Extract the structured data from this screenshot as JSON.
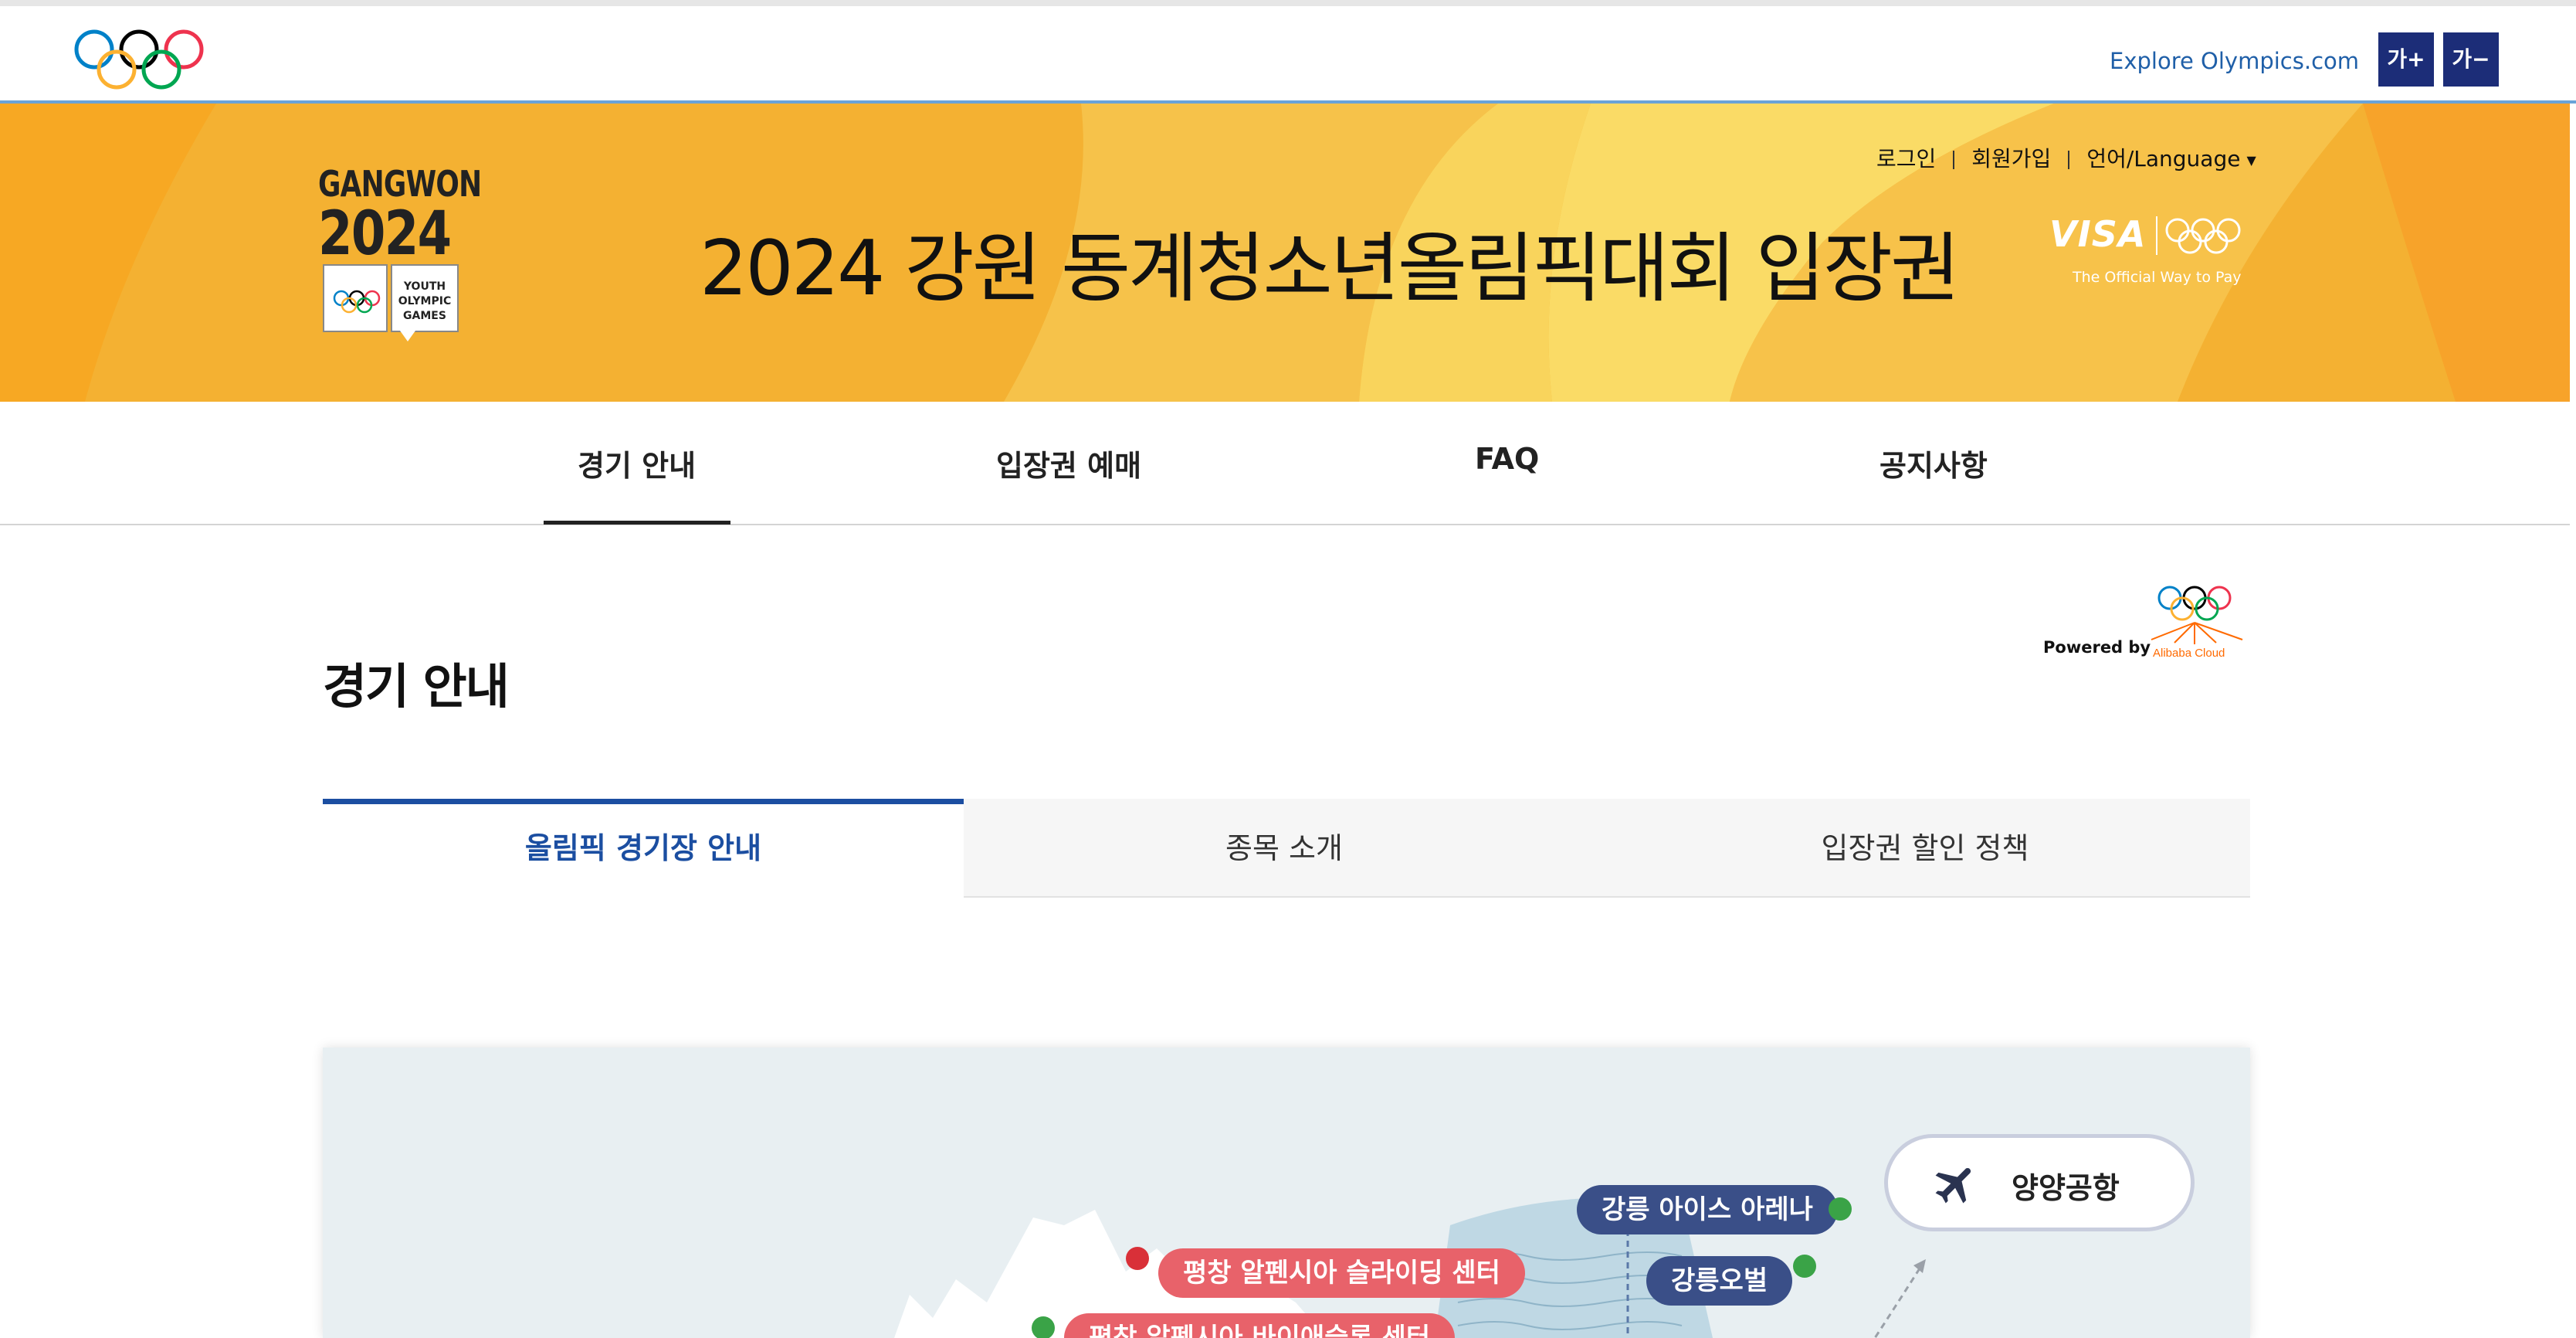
{
  "topbar": {
    "explore_link": "Explore Olympics.com",
    "font_plus": "가+",
    "font_minus": "가−",
    "ring_colors": [
      "#0081c8",
      "#fcb131",
      "#000000",
      "#00a651",
      "#ee334e"
    ]
  },
  "banner": {
    "logo_line1": "GANGWON",
    "logo_line2": "2024",
    "logo_badge_line1": "YOUTH",
    "logo_badge_line2": "OLYMPIC",
    "logo_badge_line3": "GAMES",
    "title": "2024 강원 동계청소년올림픽대회 입장권",
    "login": "로그인",
    "signup": "회원가입",
    "language": "언어/Language",
    "visa_word": "VISA",
    "visa_tagline": "The Official Way to Pay",
    "accent_color": "#f5b838"
  },
  "nav": {
    "items": [
      {
        "label": "경기 안내"
      },
      {
        "label": "입장권 예매"
      },
      {
        "label": "FAQ"
      },
      {
        "label": "공지사항"
      }
    ]
  },
  "content": {
    "heading": "경기 안내",
    "powered_by": "Powered by",
    "partner": "Alibaba Cloud",
    "tabs": [
      {
        "label": "올림픽 경기장 안내",
        "active": true
      },
      {
        "label": "종목 소개",
        "active": false
      },
      {
        "label": "입장권 할인 정책",
        "active": false
      }
    ],
    "active_tab_color": "#1b4ea1"
  },
  "map": {
    "airport": "양양공항",
    "venues": [
      {
        "label": "강릉 아이스 아레나"
      },
      {
        "label": "강릉오벌"
      },
      {
        "label": "평창 알펜시아 슬라이딩 센터"
      },
      {
        "label": "평창 알펜시아 바이애슬론 센터"
      }
    ]
  }
}
